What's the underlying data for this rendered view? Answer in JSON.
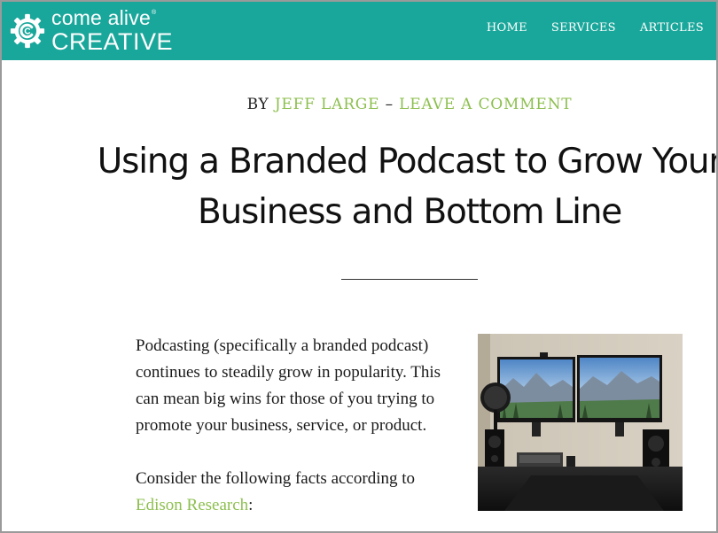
{
  "header": {
    "logo": {
      "line1": "come alive",
      "trademark": "®",
      "line2": "CREATIVE"
    },
    "nav": [
      {
        "label": "HOME"
      },
      {
        "label": "SERVICES"
      },
      {
        "label": "ARTICLES"
      }
    ]
  },
  "article": {
    "byline": {
      "by": "BY",
      "author": "JEFF LARGE",
      "dash": "–",
      "comment": "LEAVE A COMMENT"
    },
    "title": "Using a Branded Podcast to Grow Your Business and Bottom Line",
    "paragraphs": {
      "p1": "Podcasting (specifically a branded podcast) continues to steadily grow in popularity. This can mean big wins for those of you trying to promote your business, service, or product.",
      "p2_prefix": "Consider the following facts according to ",
      "p2_link": "Edison Research",
      "p2_suffix": ":"
    },
    "image": {
      "icon": "podcast-studio-photo"
    }
  },
  "colors": {
    "header_bg": "#1aa79b",
    "link_green": "#8dbf4f",
    "frame_border": "#9a9a9a"
  }
}
